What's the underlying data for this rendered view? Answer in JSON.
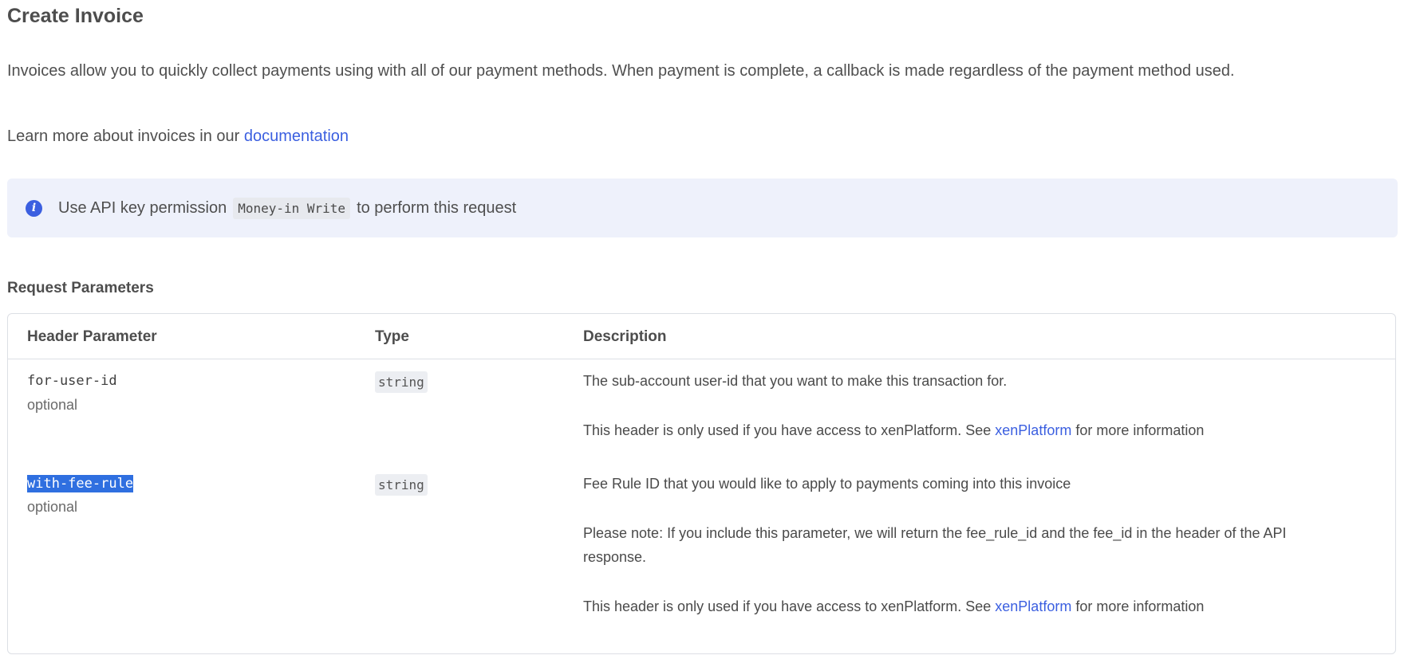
{
  "page": {
    "title": "Create Invoice",
    "intro": "Invoices allow you to quickly collect payments using with all of our payment methods. When payment is complete, a callback is made regardless of the payment method used.",
    "learn_more_prefix": "Learn more about invoices in our ",
    "learn_more_link": "documentation"
  },
  "callout": {
    "icon": "info-icon",
    "prefix": "Use API key permission",
    "permission": "Money-in Write",
    "suffix": "to perform this request"
  },
  "request_parameters": {
    "title": "Request Parameters",
    "columns": {
      "name": "Header Parameter",
      "type": "Type",
      "description": "Description"
    },
    "rows": [
      {
        "name": "for-user-id",
        "requirement": "optional",
        "type": "string",
        "desc1": "The sub-account user-id that you want to make this transaction for.",
        "desc_note_prefix": "This header is only used if you have access to xenPlatform. See ",
        "desc_note_link": "xenPlatform",
        "desc_note_suffix": " for more information"
      },
      {
        "name": "with-fee-rule",
        "requirement": "optional",
        "type": "string",
        "desc1": "Fee Rule ID that you would like to apply to payments coming into this invoice",
        "desc2": "Please note: If you include this parameter, we will return the fee_rule_id and the fee_id in the header of the API response.",
        "desc_note_prefix": "This header is only used if you have access to xenPlatform. See ",
        "desc_note_link": "xenPlatform",
        "desc_note_suffix": " for more information"
      }
    ]
  },
  "colors": {
    "link": "#3b5fe0",
    "callout_bg": "#eef1fb",
    "selection": "#2f6fe0"
  }
}
